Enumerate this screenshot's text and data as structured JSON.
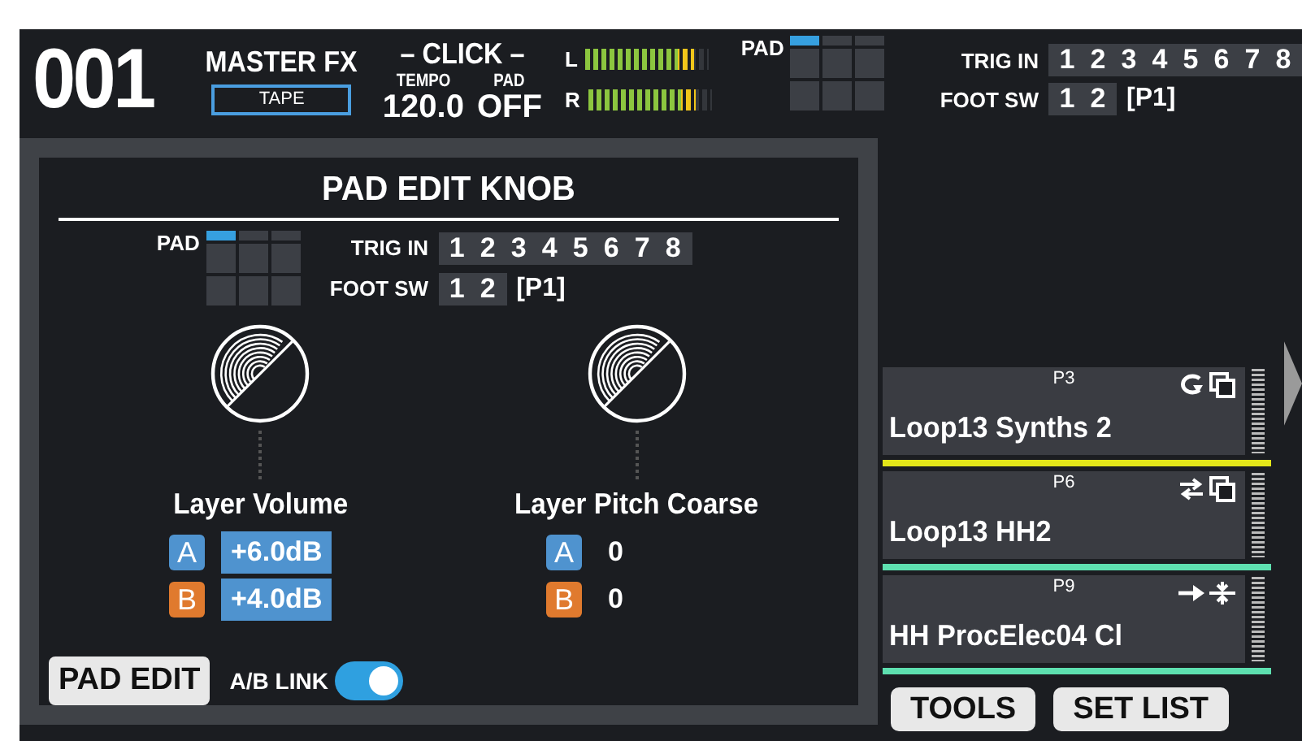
{
  "header": {
    "program_number": "001",
    "master_fx": {
      "label": "MASTER FX",
      "value": "TAPE"
    },
    "click": {
      "title": "– CLICK –",
      "tempo_label": "TEMPO",
      "tempo": "120.0",
      "pad_label": "PAD",
      "pad": "OFF"
    },
    "meters": [
      {
        "label": "L",
        "level": 0.87
      },
      {
        "label": "R",
        "level": 0.87
      }
    ],
    "pad_map": {
      "label": "PAD",
      "pads": [
        {
          "selected": true
        },
        {
          "selected": false
        },
        {
          "selected": false
        },
        {
          "selected": false
        },
        {
          "selected": false
        },
        {
          "selected": false
        },
        {
          "selected": false
        },
        {
          "selected": false
        },
        {
          "selected": false
        }
      ]
    },
    "trig_in": {
      "label": "TRIG IN",
      "inputs": [
        "1",
        "2",
        "3",
        "4",
        "5",
        "6",
        "7",
        "8"
      ]
    },
    "foot_sw": {
      "label": "FOOT SW",
      "inputs": [
        "1",
        "2"
      ],
      "bank": "[P1]"
    }
  },
  "panel": {
    "title": "PAD EDIT KNOB",
    "pad_map": {
      "label": "PAD",
      "pads": [
        {
          "selected": true
        },
        {
          "selected": false
        },
        {
          "selected": false
        },
        {
          "selected": false
        },
        {
          "selected": false
        },
        {
          "selected": false
        },
        {
          "selected": false
        },
        {
          "selected": false
        },
        {
          "selected": false
        }
      ]
    },
    "trig_in": {
      "label": "TRIG IN",
      "inputs": [
        "1",
        "2",
        "3",
        "4",
        "5",
        "6",
        "7",
        "8"
      ]
    },
    "foot_sw": {
      "label": "FOOT SW",
      "inputs": [
        "1",
        "2"
      ],
      "bank": "[P1]"
    },
    "knobs": [
      {
        "name": "Layer Volume",
        "layers": [
          {
            "label": "A",
            "color": "#4f93cf",
            "value": "+6.0dB",
            "selected": true
          },
          {
            "label": "B",
            "color": "#e07a2e",
            "value": "+4.0dB",
            "selected": true
          }
        ]
      },
      {
        "name": "Layer Pitch Coarse",
        "layers": [
          {
            "label": "A",
            "color": "#4f93cf",
            "value": "0",
            "selected": false
          },
          {
            "label": "B",
            "color": "#e07a2e",
            "value": "0",
            "selected": false
          }
        ]
      }
    ],
    "pad_edit_button": "PAD EDIT",
    "ab_link": {
      "label": "A/B LINK",
      "on": true
    }
  },
  "samples": [
    {
      "bank": "P3",
      "name": "Loop13 Synths 2",
      "color": "#e3e619",
      "icons": [
        {
          "kind": "loop"
        },
        {
          "kind": "layer"
        }
      ]
    },
    {
      "bank": "P6",
      "name": "Loop13 HH2",
      "color": "#5ee0b0",
      "icons": [
        {
          "kind": "alternate"
        },
        {
          "kind": "layer"
        }
      ]
    },
    {
      "bank": "P9",
      "name": "HH ProcElec04 Cl",
      "color": "#5ee0b0",
      "icons": [
        {
          "kind": "oneshot"
        },
        {
          "kind": "split"
        }
      ]
    }
  ],
  "buttons": [
    "TOOLS",
    "SET LIST"
  ]
}
